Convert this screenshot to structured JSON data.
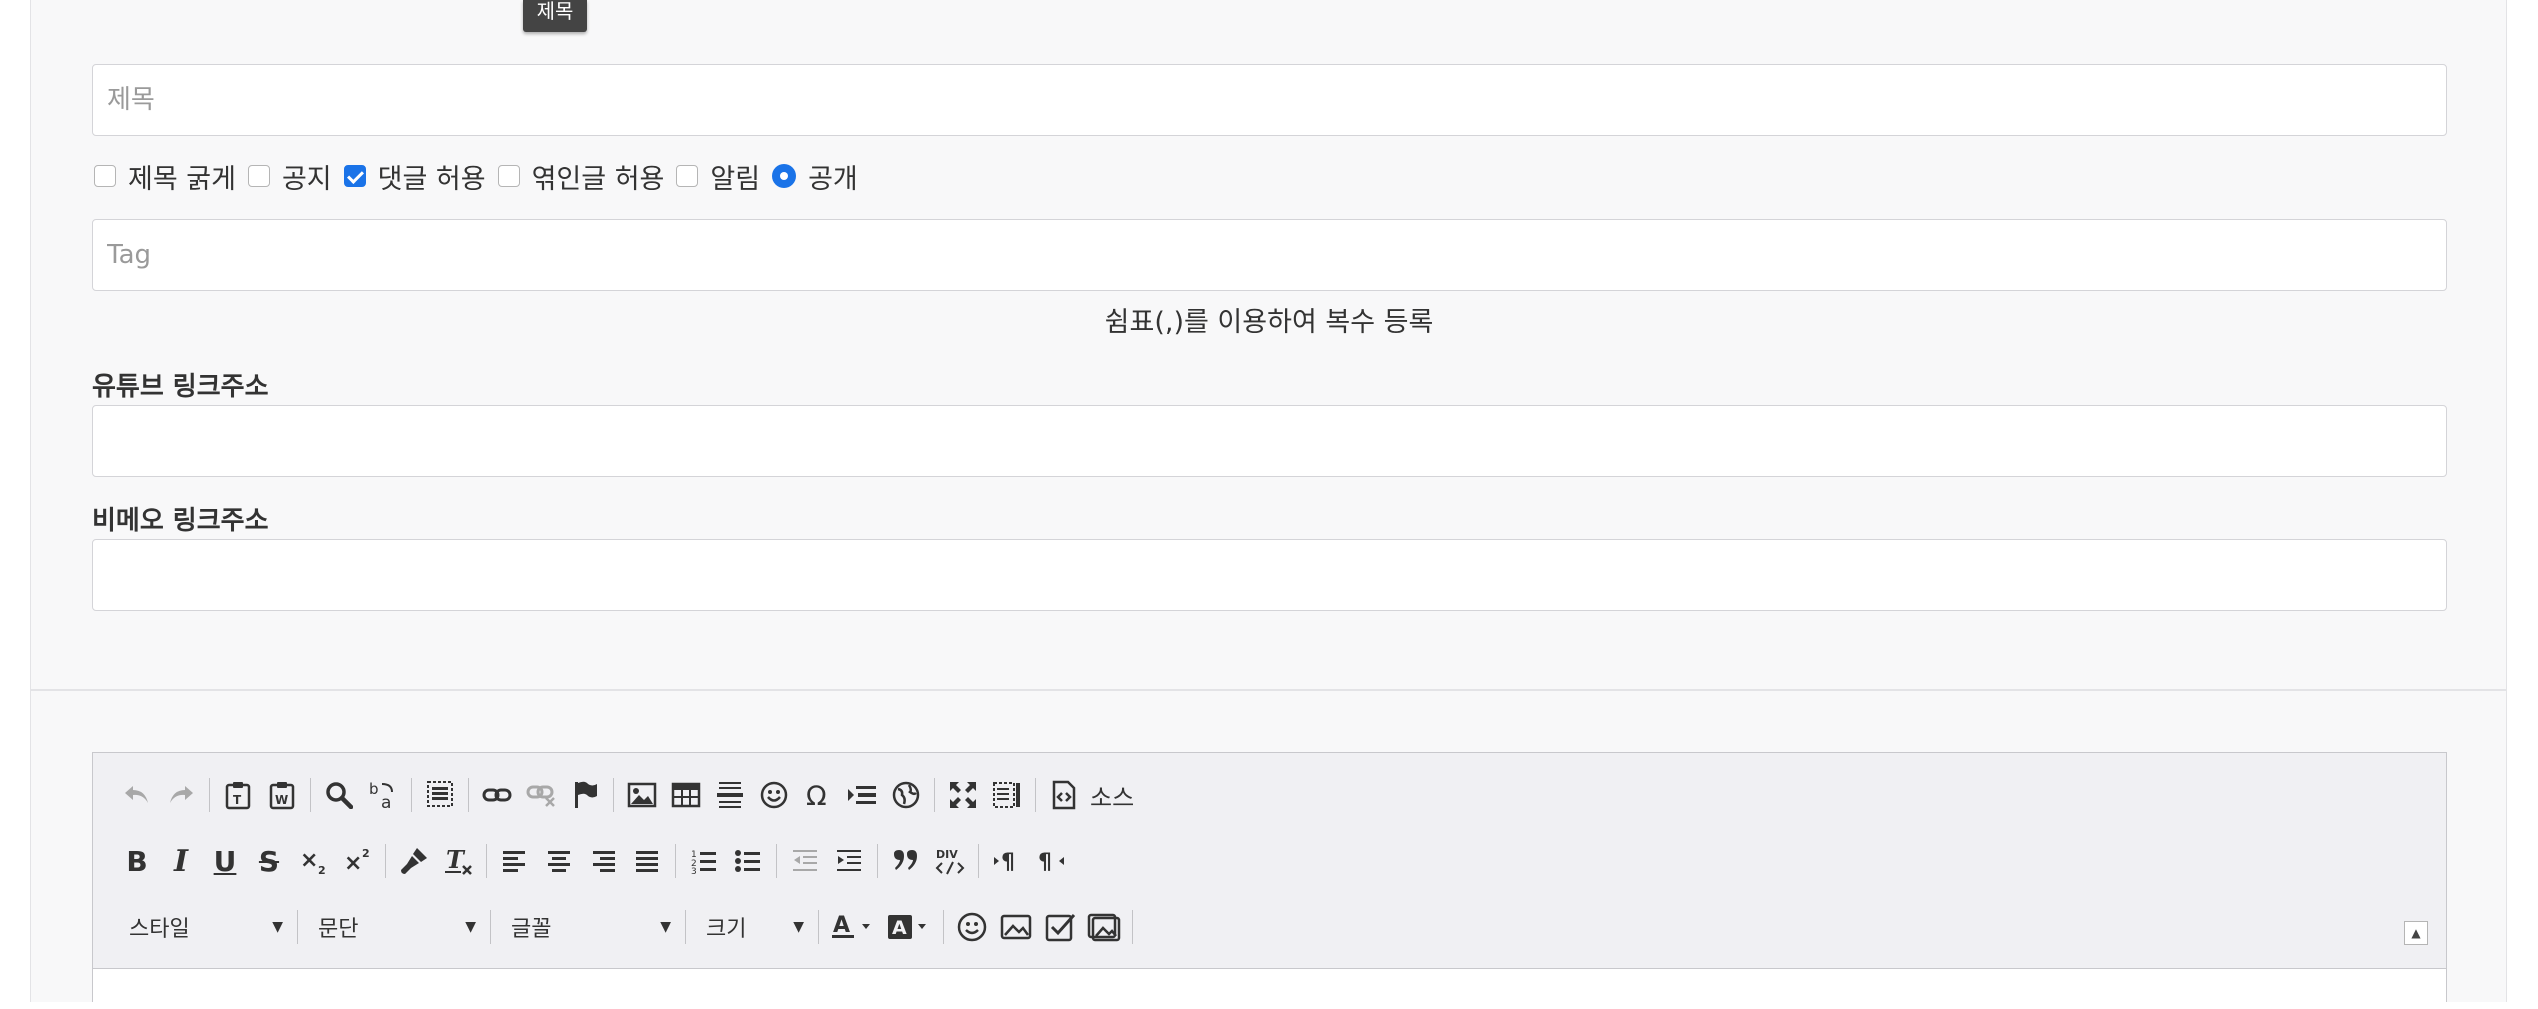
{
  "tooltip": {
    "text": "제목"
  },
  "title_field": {
    "placeholder": "제목",
    "value": ""
  },
  "options": [
    {
      "label": "제목 굵게",
      "type": "checkbox",
      "checked": false
    },
    {
      "label": "공지",
      "type": "checkbox",
      "checked": false
    },
    {
      "label": "댓글 허용",
      "type": "checkbox",
      "checked": true
    },
    {
      "label": "엮인글 허용",
      "type": "checkbox",
      "checked": false
    },
    {
      "label": "알림",
      "type": "checkbox",
      "checked": false
    },
    {
      "label": "공개",
      "type": "radio",
      "checked": true
    }
  ],
  "tag_field": {
    "placeholder": "Tag",
    "value": ""
  },
  "tag_help": "쉼표(,)를 이용하여 복수 등록",
  "youtube": {
    "label": "유튜브 링크주소",
    "value": ""
  },
  "vimeo": {
    "label": "비메오 링크주소",
    "value": ""
  },
  "editor": {
    "source_label": "소스",
    "style_label": "스타일",
    "format_label": "문단",
    "font_label": "글꼴",
    "size_label": "크기",
    "accent_color": "#1a73e8"
  }
}
